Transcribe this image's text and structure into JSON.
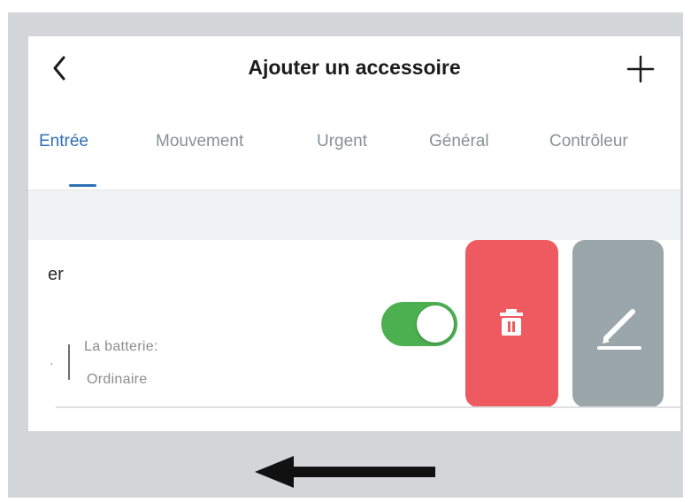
{
  "header": {
    "title": "Ajouter un accessoire",
    "back_icon": "chevron-left-icon",
    "add_icon": "plus-icon"
  },
  "tabs": [
    {
      "label": "Entrée",
      "active": true
    },
    {
      "label": "Mouvement",
      "active": false
    },
    {
      "label": "Urgent",
      "active": false
    },
    {
      "label": "Général",
      "active": false
    },
    {
      "label": "Contrôleur",
      "active": false
    }
  ],
  "accessory": {
    "name_fragment": "er",
    "dot_fragment": ".",
    "battery_label": "La batterie:",
    "battery_value": "Ordinaire",
    "toggle_on": true
  },
  "swipe_actions": {
    "delete_icon": "trash-icon",
    "edit_icon": "pencil-icon"
  },
  "hint": {
    "swipe_arrow_icon": "left-arrow-icon"
  },
  "colors": {
    "accent": "#2f6fb6",
    "toggle_on": "#4caf50",
    "delete": "#ee5a5f",
    "edit": "#9aa6aa",
    "frame": "#d4d5d7"
  }
}
